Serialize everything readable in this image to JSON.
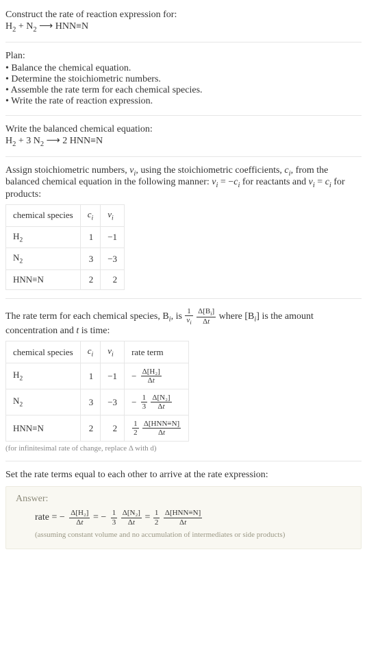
{
  "intro": {
    "prompt": "Construct the rate of reaction expression for:",
    "unbalanced_lhs1": "H",
    "unbalanced_lhs1_sub": "2",
    "plus": " + ",
    "unbalanced_lhs2": "N",
    "unbalanced_lhs2_sub": "2",
    "arrow": " ⟶ ",
    "unbalanced_rhs": "HNN≡N"
  },
  "plan": {
    "heading": "Plan:",
    "items": [
      "Balance the chemical equation.",
      "Determine the stoichiometric numbers.",
      "Assemble the rate term for each chemical species.",
      "Write the rate of reaction expression."
    ]
  },
  "balanced": {
    "heading": "Write the balanced chemical equation:",
    "lhs1": "H",
    "lhs1_sub": "2",
    "plus": " + 3 ",
    "lhs2": "N",
    "lhs2_sub": "2",
    "arrow": " ⟶ 2 ",
    "rhs": "HNN≡N"
  },
  "stoich": {
    "text_a": "Assign stoichiometric numbers, ",
    "nu": "ν",
    "sub_i": "i",
    "text_b": ", using the stoichiometric coefficients, ",
    "c": "c",
    "text_c": ", from the balanced chemical equation in the following manner: ",
    "rel_reactants": " = −",
    "text_d": " for reactants and ",
    "rel_products": " = ",
    "text_e": " for products:",
    "headers": {
      "species": "chemical species",
      "c": "c",
      "nu": "ν",
      "i": "i"
    },
    "rows": [
      {
        "sp_a": "H",
        "sp_sub": "2",
        "c": "1",
        "nu": "−1"
      },
      {
        "sp_a": "N",
        "sp_sub": "2",
        "c": "3",
        "nu": "−3"
      },
      {
        "sp_a": "HNN≡N",
        "sp_sub": "",
        "c": "2",
        "nu": "2"
      }
    ]
  },
  "rate_term": {
    "text_a": "The rate term for each chemical species, B",
    "sub_i": "i",
    "text_b": ", is ",
    "one": "1",
    "nu": "ν",
    "delta": "Δ",
    "lb": "[B",
    "rb": "]",
    "t": "t",
    "text_c": " where [B",
    "text_d": "] is the amount concentration and ",
    "t_word": "t",
    "text_e": " is time:",
    "headers": {
      "species": "chemical species",
      "c": "c",
      "nu": "ν",
      "i": "i",
      "rate": "rate term"
    },
    "rows": [
      {
        "sp_a": "H",
        "sp_sub": "2",
        "c": "1",
        "nu": "−1",
        "neg": "−",
        "coef_num": "",
        "coef_den": "",
        "conc": "[H₂]"
      },
      {
        "sp_a": "N",
        "sp_sub": "2",
        "c": "3",
        "nu": "−3",
        "neg": "−",
        "coef_num": "1",
        "coef_den": "3",
        "conc": "[N₂]"
      },
      {
        "sp_a": "HNN≡N",
        "sp_sub": "",
        "c": "2",
        "nu": "2",
        "neg": "",
        "coef_num": "1",
        "coef_den": "2",
        "conc": "[HNN≡N]"
      }
    ],
    "footnote": "(for infinitesimal rate of change, replace Δ with d)"
  },
  "final": {
    "heading": "Set the rate terms equal to each other to arrive at the rate expression:",
    "answer_label": "Answer:",
    "rate_word": "rate = ",
    "neg": "−",
    "eq": " = ",
    "terms": [
      {
        "neg": "−",
        "coef_num": "",
        "coef_den": "",
        "conc": "[H₂]"
      },
      {
        "neg": "−",
        "coef_num": "1",
        "coef_den": "3",
        "conc": "[N₂]"
      },
      {
        "neg": "",
        "coef_num": "1",
        "coef_den": "2",
        "conc": "[HNN≡N]"
      }
    ],
    "delta": "Δ",
    "t": "t",
    "note": "(assuming constant volume and no accumulation of intermediates or side products)"
  },
  "chart_data": {
    "type": "table",
    "tables": [
      {
        "title": "Stoichiometric numbers",
        "columns": [
          "chemical species",
          "c_i",
          "ν_i"
        ],
        "rows": [
          [
            "H2",
            1,
            -1
          ],
          [
            "N2",
            3,
            -3
          ],
          [
            "HNN≡N",
            2,
            2
          ]
        ]
      },
      {
        "title": "Rate terms",
        "columns": [
          "chemical species",
          "c_i",
          "ν_i",
          "rate term"
        ],
        "rows": [
          [
            "H2",
            1,
            -1,
            "-(Δ[H2]/Δt)"
          ],
          [
            "N2",
            3,
            -3,
            "-(1/3)(Δ[N2]/Δt)"
          ],
          [
            "HNN≡N",
            2,
            2,
            "(1/2)(Δ[HNN≡N]/Δt)"
          ]
        ]
      }
    ],
    "rate_expression": "rate = -(Δ[H2]/Δt) = -(1/3)(Δ[N2]/Δt) = (1/2)(Δ[HNN≡N]/Δt)"
  }
}
